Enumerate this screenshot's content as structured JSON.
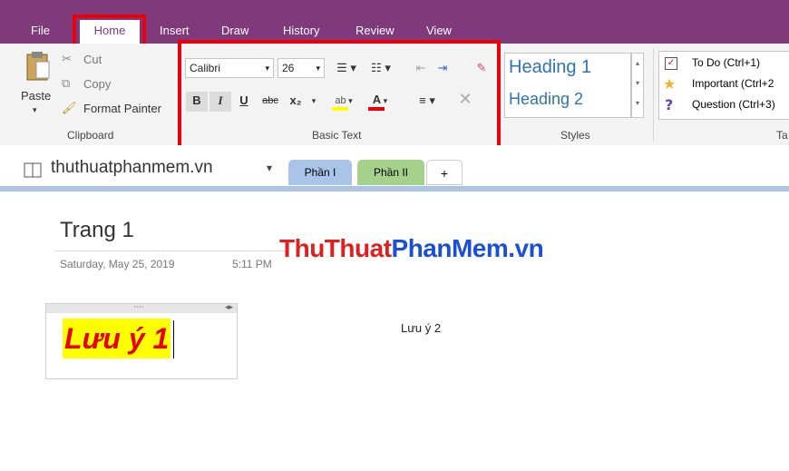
{
  "tabs": {
    "file": "File",
    "home": "Home",
    "insert": "Insert",
    "draw": "Draw",
    "history": "History",
    "review": "Review",
    "view": "View"
  },
  "clipboard": {
    "paste": "Paste",
    "cut": "Cut",
    "copy": "Copy",
    "format_painter": "Format Painter",
    "label": "Clipboard"
  },
  "basic_text": {
    "font": "Calibri",
    "size": "26",
    "label": "Basic Text",
    "bold": "B",
    "italic": "I",
    "underline": "U",
    "strike": "abc",
    "subscript": "x₂"
  },
  "styles": {
    "heading1": "Heading 1",
    "heading2": "Heading 2",
    "label": "Styles"
  },
  "tags": {
    "todo": "To Do (Ctrl+1)",
    "important": "Important (Ctrl+2",
    "question": "Question (Ctrl+3)",
    "label": "Ta"
  },
  "notebook": {
    "name": "thuthuatphanmem.vn",
    "sections": [
      "Phần I",
      "Phần II",
      "+"
    ]
  },
  "page": {
    "title": "Trang 1",
    "date": "Saturday, May 25, 2019",
    "time": "5:11 PM",
    "watermark_left": "ThuThuat",
    "watermark_right": "PhanMem.vn",
    "note1": "Lưu ý 1",
    "note2": "Lưu ý 2"
  },
  "colors": {
    "brand": "#80397b",
    "highlight": "#ffff00",
    "note_red": "#e8000b",
    "heading_blue": "#2e74b5",
    "selected_tab": "#a9c4e6",
    "section2": "#a6d18a"
  }
}
